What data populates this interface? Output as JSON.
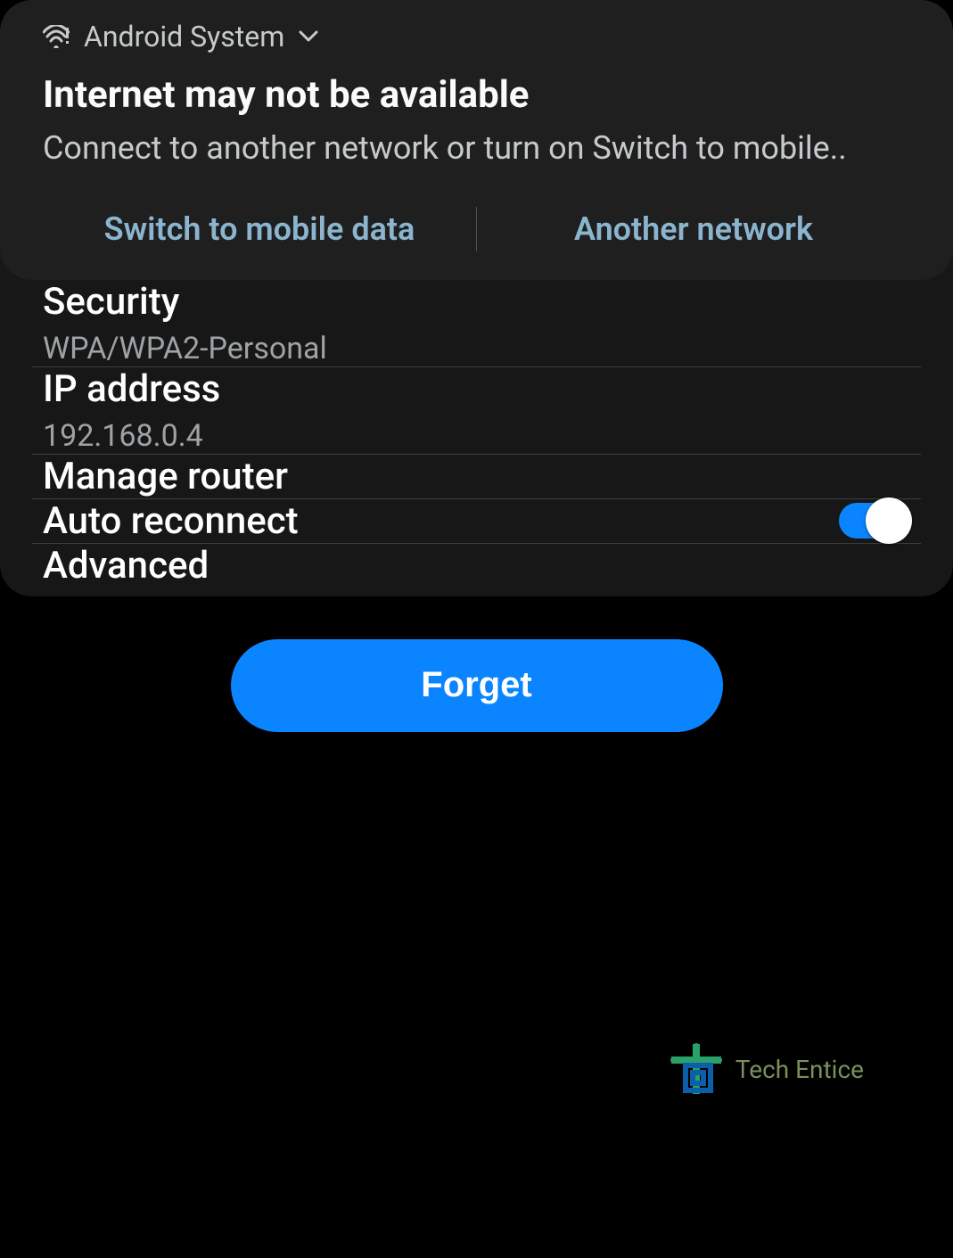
{
  "notification": {
    "app_name": "Android System",
    "title": "Internet may not be available",
    "subtitle": "Connect to another network or turn on Switch to mobile..",
    "action_switch": "Switch to mobile data",
    "action_other": "Another network"
  },
  "rows": {
    "security": {
      "label": "Security",
      "value": "WPA/WPA2-Personal"
    },
    "ip": {
      "label": "IP address",
      "value": "192.168.0.4"
    },
    "router": {
      "label": "Manage router"
    },
    "auto": {
      "label": "Auto reconnect",
      "enabled": true
    },
    "advanced": {
      "label": "Advanced"
    }
  },
  "forget_button": "Forget",
  "watermark": "Tech Entice",
  "colors": {
    "accent": "#0b84ff"
  }
}
